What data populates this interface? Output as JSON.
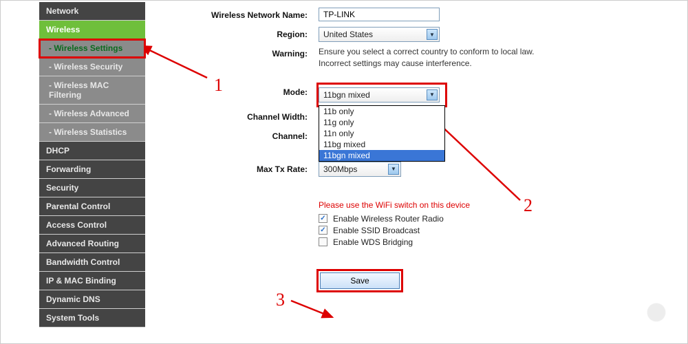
{
  "sidebar": {
    "items": [
      {
        "label": "Network",
        "type": "top"
      },
      {
        "label": "Wireless",
        "type": "top-active"
      },
      {
        "label": "- Wireless Settings",
        "type": "sub",
        "highlight": true
      },
      {
        "label": "- Wireless Security",
        "type": "sub"
      },
      {
        "label": "- Wireless MAC Filtering",
        "type": "sub"
      },
      {
        "label": "- Wireless Advanced",
        "type": "sub"
      },
      {
        "label": "- Wireless Statistics",
        "type": "sub"
      },
      {
        "label": "DHCP",
        "type": "top"
      },
      {
        "label": "Forwarding",
        "type": "top"
      },
      {
        "label": "Security",
        "type": "top"
      },
      {
        "label": "Parental Control",
        "type": "top"
      },
      {
        "label": "Access Control",
        "type": "top"
      },
      {
        "label": "Advanced Routing",
        "type": "top"
      },
      {
        "label": "Bandwidth Control",
        "type": "top"
      },
      {
        "label": "IP & MAC Binding",
        "type": "top"
      },
      {
        "label": "Dynamic DNS",
        "type": "top"
      },
      {
        "label": "System Tools",
        "type": "top"
      }
    ]
  },
  "form": {
    "name_label": "Wireless Network Name:",
    "name_value": "TP-LINK",
    "region_label": "Region:",
    "region_value": "United States",
    "warning_label": "Warning:",
    "warning_text": "Ensure you select a correct country to conform to local law.\nIncorrect settings may cause interference.",
    "mode_label": "Mode:",
    "mode_value": "11bgn mixed",
    "mode_options": [
      "11b only",
      "11g only",
      "11n only",
      "11bg mixed",
      "11bgn mixed"
    ],
    "mode_selected_index": 4,
    "channel_width_label": "Channel Width:",
    "channel_label": "Channel:",
    "max_tx_label": "Max Tx Rate:",
    "max_tx_value": "300Mbps",
    "red_note": "Please use the WiFi switch on this device",
    "cb1_label": "Enable Wireless Router Radio",
    "cb1_checked": true,
    "cb2_label": "Enable SSID Broadcast",
    "cb2_checked": true,
    "cb3_label": "Enable WDS Bridging",
    "cb3_checked": false,
    "save_label": "Save"
  },
  "annotations": {
    "n1": "1",
    "n2": "2",
    "n3": "3"
  }
}
